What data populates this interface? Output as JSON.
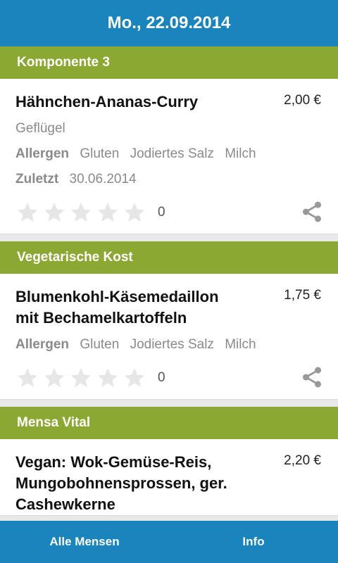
{
  "header": {
    "title": "Mo., 22.09.2014"
  },
  "sections": [
    {
      "label": "Komponente 3",
      "meal": {
        "name": "Hähnchen-Ananas-Curry",
        "price": "2,00 €",
        "category": "Geflügel",
        "allergen_label": "Allergen",
        "allergens": [
          "Gluten",
          "Jodiertes Salz",
          "Milch"
        ],
        "last_label": "Zuletzt",
        "last_date": "30.06.2014",
        "rating_count": "0"
      }
    },
    {
      "label": "Vegetarische Kost",
      "meal": {
        "name_line1": "Blumenkohl-Käsemedaillon",
        "name_line2": "mit Bechamelkartoffeln",
        "price": "1,75 €",
        "allergen_label": "Allergen",
        "allergens": [
          "Gluten",
          "Jodiertes Salz",
          "Milch"
        ],
        "rating_count": "0"
      }
    },
    {
      "label": "Mensa Vital",
      "meal": {
        "name_line1": "Vegan: Wok-Gemüse-Reis,",
        "name_line2": "Mungobohnensprossen, ger.",
        "name_line3": "Cashewkerne",
        "price": "2,20 €"
      }
    }
  ],
  "bottom_nav": {
    "left": "Alle Mensen",
    "right": "Info"
  },
  "colors": {
    "primary": "#1a84bd",
    "section": "#8ba833"
  },
  "icons": {
    "star": "star-icon",
    "share": "share-icon"
  }
}
